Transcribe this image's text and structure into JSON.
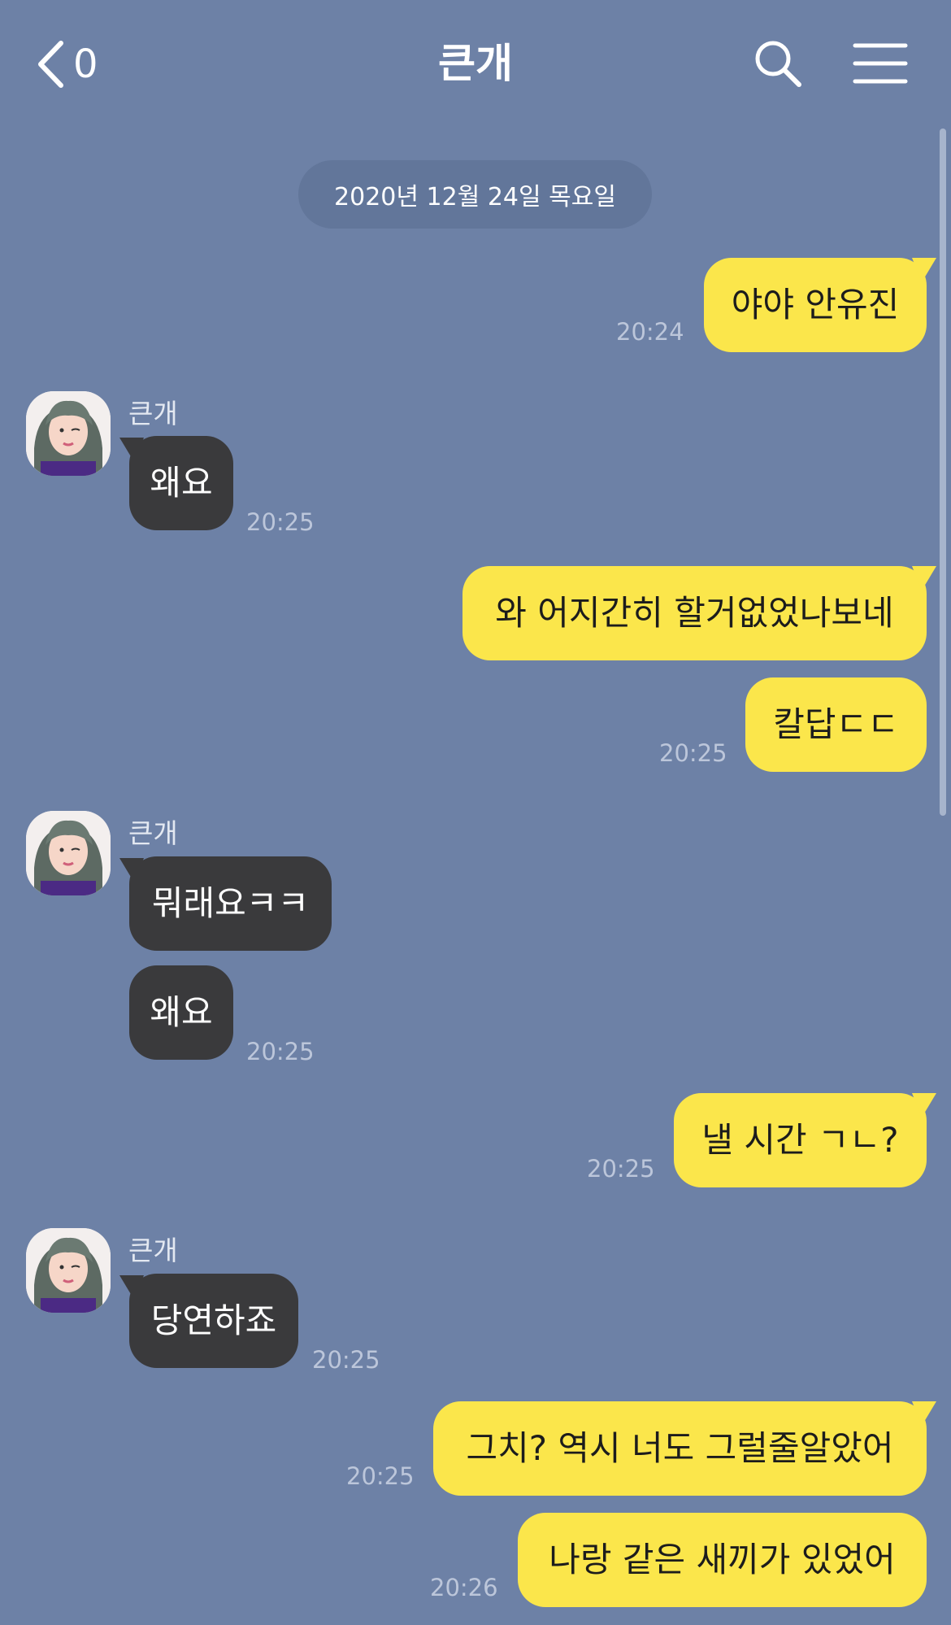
{
  "header": {
    "back_count": "0",
    "title": "큰개"
  },
  "date_divider": "2020년 12월 24일 목요일",
  "messages": [
    {
      "sender": "me",
      "text": "야야 안유진",
      "time": "20:24"
    },
    {
      "sender": "them",
      "name": "큰개",
      "text": "왜요",
      "time": "20:25"
    },
    {
      "sender": "me",
      "text": "와 어지간히 할거없었나보네",
      "time": ""
    },
    {
      "sender": "me",
      "text": "칼답ㄷㄷ",
      "time": "20:25"
    },
    {
      "sender": "them",
      "name": "큰개",
      "text": "뭐래요ㅋㅋ",
      "time": ""
    },
    {
      "sender": "them",
      "text": "왜요",
      "time": "20:25"
    },
    {
      "sender": "me",
      "text": "낼 시간 ㄱㄴ?",
      "time": "20:25"
    },
    {
      "sender": "them",
      "name": "큰개",
      "text": "당연하죠",
      "time": "20:25"
    },
    {
      "sender": "me",
      "text": "그치? 역시 너도 그럴줄알았어",
      "time": "20:25"
    },
    {
      "sender": "me",
      "text": "나랑 같은 새끼가 있었어",
      "time": "20:26"
    }
  ],
  "colors": {
    "background": "#6d81a6",
    "my_bubble": "#fbe64b",
    "their_bubble": "#3a3a3c",
    "time_text": "#bcc6da"
  },
  "icons": {
    "back": "chevron-left-icon",
    "search": "search-icon",
    "menu": "hamburger-menu-icon"
  }
}
